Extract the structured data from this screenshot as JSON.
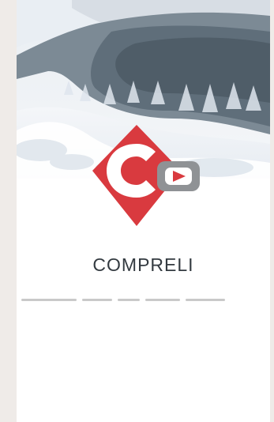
{
  "app": {
    "brand_name": "COMPRELI",
    "tagline": ""
  },
  "colors": {
    "background": "#efebe8",
    "card": "#ffffff",
    "brand_red": "#d93a3f",
    "brand_gray": "#8f9295",
    "text": "#333a40"
  },
  "icons": {
    "logo": "compreli-logo-icon",
    "hero": "snowy-forest-hero-image"
  }
}
